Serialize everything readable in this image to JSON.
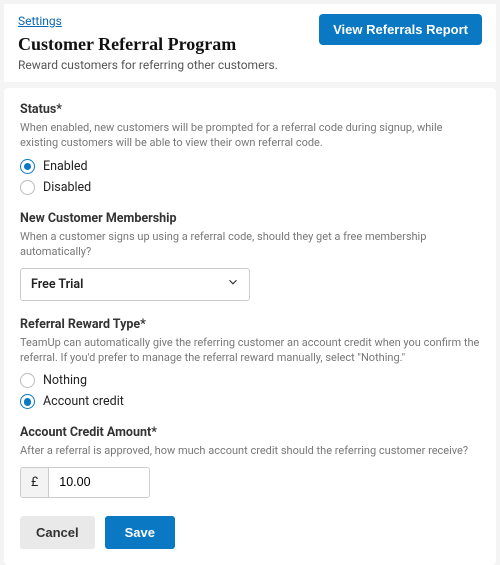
{
  "breadcrumb": {
    "settings": "Settings"
  },
  "header": {
    "title": "Customer Referral Program",
    "subtitle": "Reward customers for referring other customers.",
    "report_btn": "View Referrals Report"
  },
  "status": {
    "label": "Status*",
    "help": "When enabled, new customers will be prompted for a referral code during signup, while existing customers will be able to view their own referral code.",
    "options": {
      "enabled": "Enabled",
      "disabled": "Disabled"
    },
    "selected": "enabled"
  },
  "membership": {
    "label": "New Customer Membership",
    "help": "When a customer signs up using a referral code, should they get a free membership automatically?",
    "value": "Free Trial"
  },
  "reward_type": {
    "label": "Referral Reward Type*",
    "help": "TeamUp can automatically give the referring customer an account credit when you confirm the referral. If you'd prefer to manage the referral reward manually, select \"Nothing.\"",
    "options": {
      "nothing": "Nothing",
      "credit": "Account credit"
    },
    "selected": "credit"
  },
  "credit_amount": {
    "label": "Account Credit Amount*",
    "help": "After a referral is approved, how much account credit should the referring customer receive?",
    "currency": "£",
    "value": "10.00"
  },
  "actions": {
    "cancel": "Cancel",
    "save": "Save"
  }
}
